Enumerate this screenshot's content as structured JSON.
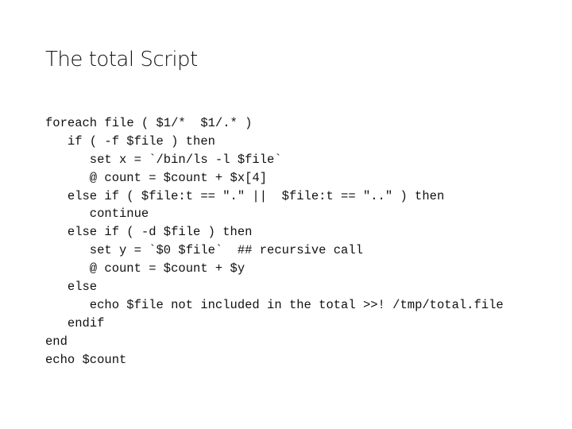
{
  "slide": {
    "title": "The total Script",
    "code_lines": [
      {
        "indent": 0,
        "text": "foreach file ( $1/*  $1/.* )"
      },
      {
        "indent": 1,
        "text": "if ( -f $file ) then"
      },
      {
        "indent": 2,
        "text": "set x = `/bin/ls -l $file`"
      },
      {
        "indent": 2,
        "text": "@ count = $count + $x[4]"
      },
      {
        "indent": 1,
        "text": "else if ( $file:t == \".\" ||  $file:t == \"..\" ) then"
      },
      {
        "indent": 2,
        "text": "continue"
      },
      {
        "indent": 1,
        "text": "else if ( -d $file ) then"
      },
      {
        "indent": 2,
        "text": "set y = `$0 $file`  ## recursive call"
      },
      {
        "indent": 2,
        "text": "@ count = $count + $y"
      },
      {
        "indent": 1,
        "text": "else"
      },
      {
        "indent": 2,
        "text": "echo $file not included in the total >>! /tmp/total.file"
      },
      {
        "indent": 1,
        "text": "endif"
      },
      {
        "indent": 0,
        "text": "end"
      },
      {
        "indent": 0,
        "text": "echo $count"
      }
    ]
  }
}
